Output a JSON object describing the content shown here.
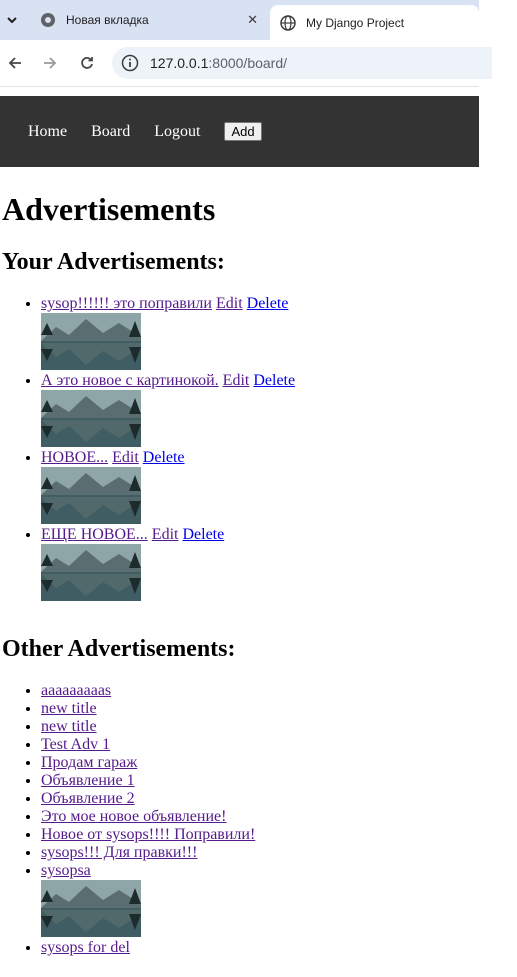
{
  "browser": {
    "tabs": [
      {
        "title": "Новая вкладка",
        "active": false
      },
      {
        "title": "My Django Project",
        "active": true
      }
    ],
    "url_host": "127.0.0.1",
    "url_path": ":8000/board/"
  },
  "nav": {
    "home": "Home",
    "board": "Board",
    "logout": "Logout",
    "add": "Add"
  },
  "page": {
    "title": "Advertisements",
    "your_heading": "Your Advertisements:",
    "other_heading": "Other Advertisements:"
  },
  "your_ads": [
    {
      "title": "sysop!!!!!! это поправили",
      "edit": "Edit",
      "delete": "Delete"
    },
    {
      "title": "А это новое с картинокой.",
      "edit": "Edit",
      "delete": "Delete"
    },
    {
      "title": "НОВОЕ...",
      "edit": "Edit",
      "delete": "Delete"
    },
    {
      "title": "ЕЩЕ НОВОЕ...",
      "edit": "Edit",
      "delete": "Delete"
    }
  ],
  "other_ads": [
    {
      "title": "aaaaaaaaas"
    },
    {
      "title": "new title"
    },
    {
      "title": "new title"
    },
    {
      "title": "Test Adv 1"
    },
    {
      "title": "Продам гараж"
    },
    {
      "title": "Объявление 1"
    },
    {
      "title": "Объявление 2"
    },
    {
      "title": "Это мое новое объявление!"
    },
    {
      "title": "Новое от sysops!!!! Поправили!"
    },
    {
      "title": "sysops!!! Для правки!!!"
    },
    {
      "title": "sysopsa"
    },
    {
      "title": "sysops for del"
    }
  ]
}
